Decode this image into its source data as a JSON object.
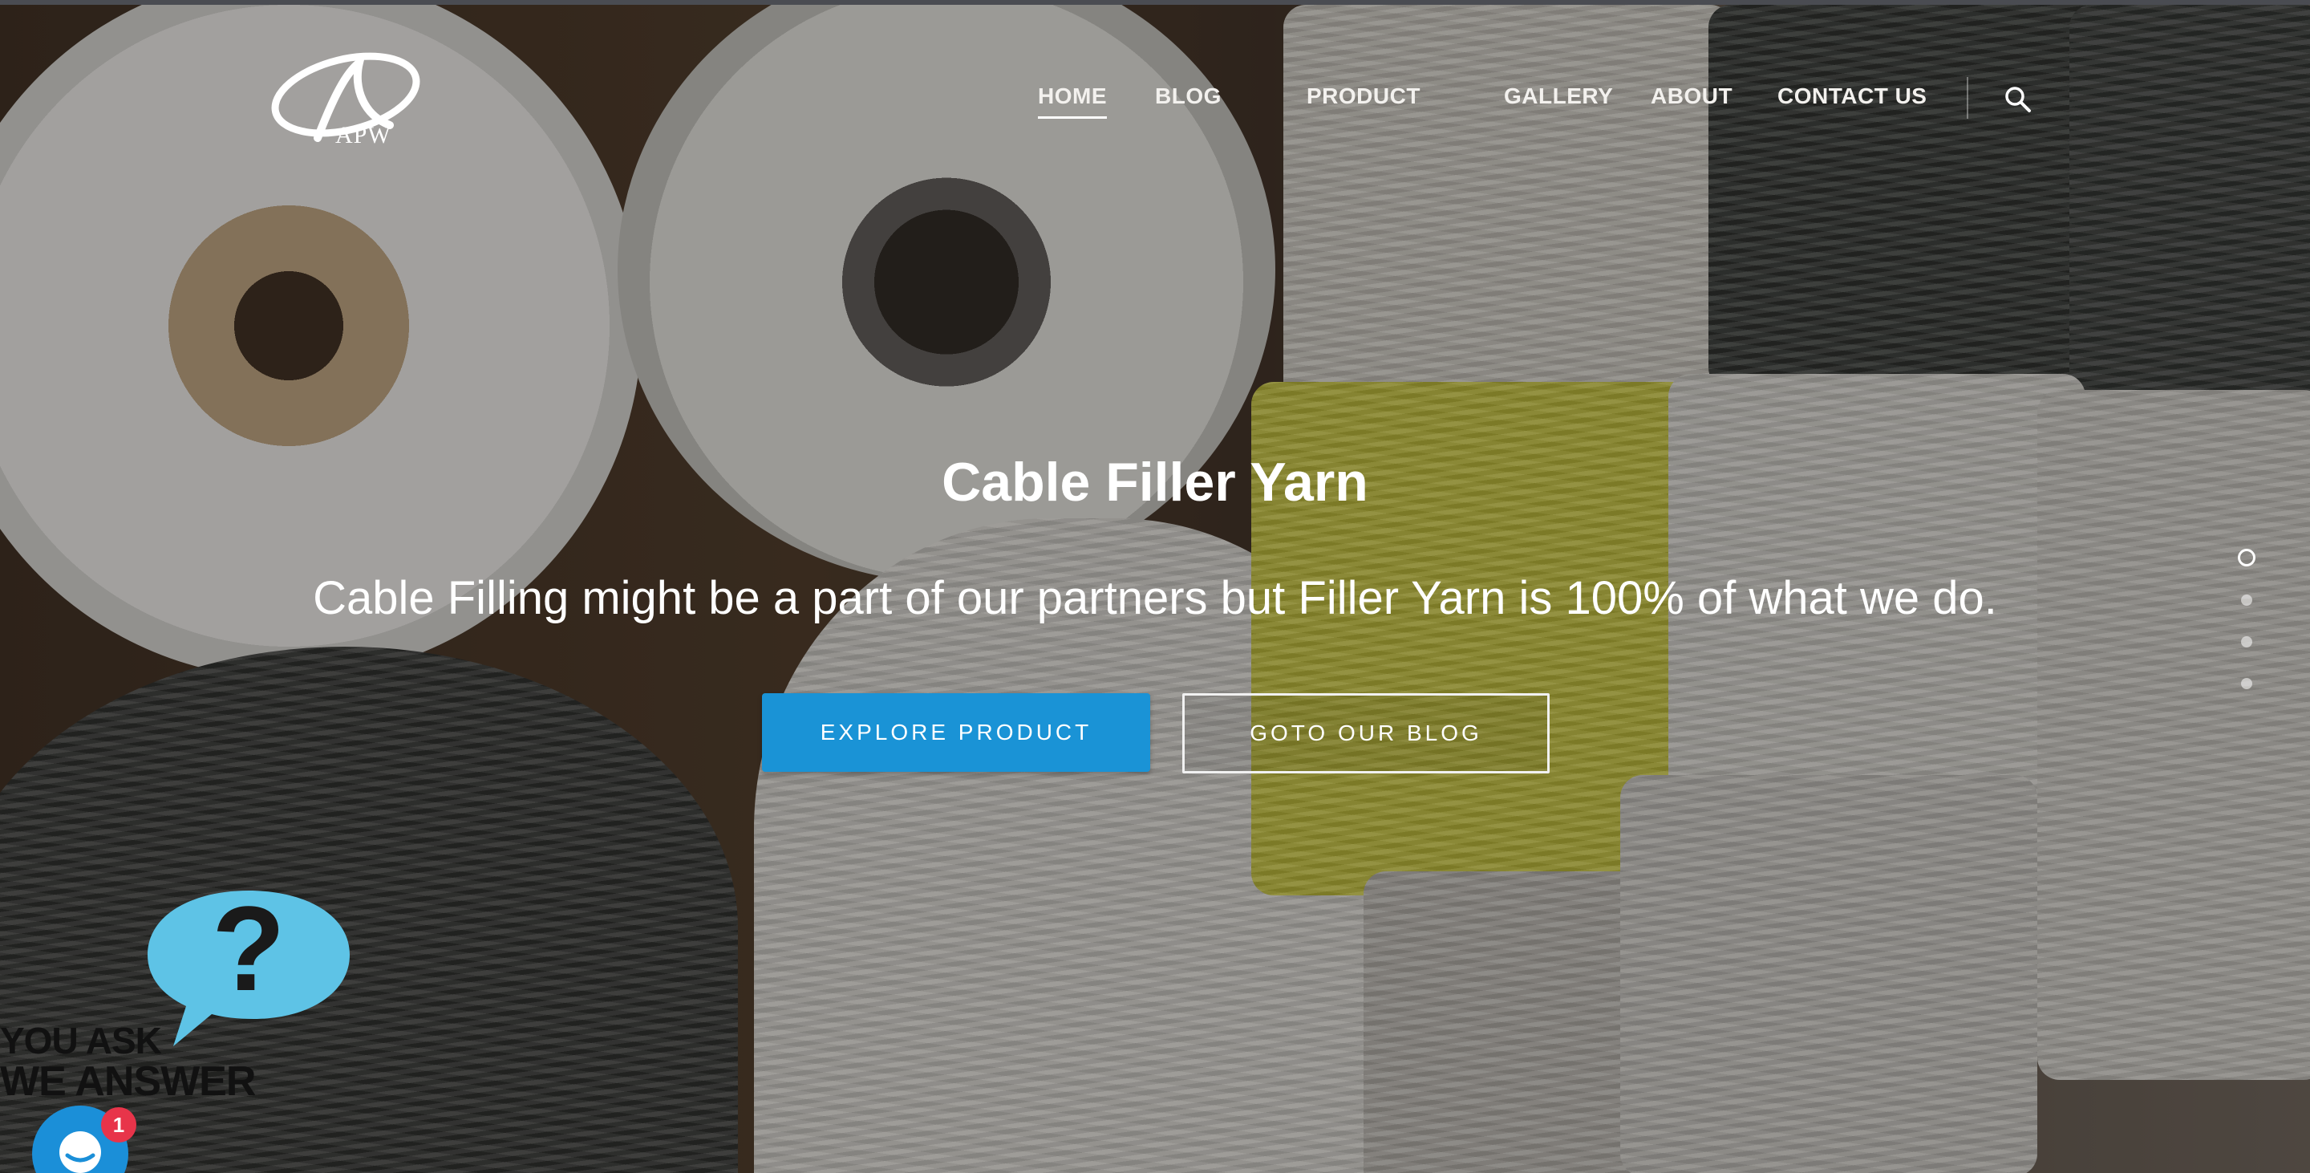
{
  "brand": {
    "logo_text": "APW"
  },
  "nav": {
    "items": [
      {
        "label": "HOME",
        "active": true
      },
      {
        "label": "BLOG",
        "active": false
      },
      {
        "label": "PRODUCT",
        "active": false
      },
      {
        "label": "GALLERY",
        "active": false
      },
      {
        "label": "ABOUT",
        "active": false
      },
      {
        "label": "CONTACT US",
        "active": false
      }
    ],
    "search_icon": "search-icon"
  },
  "hero": {
    "title": "Cable Filler Yarn",
    "subtitle": "Cable Filling might be a part of our partners but Filler Yarn is 100% of what we do.",
    "primary_button": "EXPLORE PRODUCT",
    "secondary_button": "GOTO OUR BLOG"
  },
  "slider": {
    "slide_count": 4,
    "active_index": 0
  },
  "faq_widget": {
    "symbol": "?",
    "line1": "YOU ASK",
    "line2": "WE ANSWER"
  },
  "chat": {
    "unread_count": "1"
  },
  "colors": {
    "accent": "#1a93d6",
    "faq_bubble": "#5ec3e6",
    "badge": "#e8344a"
  }
}
